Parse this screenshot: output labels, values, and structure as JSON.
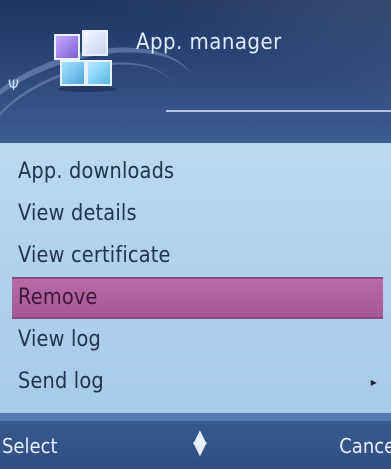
{
  "header": {
    "title": "App. manager",
    "app_icon": "app-manager-icon",
    "signal_icon": "signal-icon"
  },
  "menu": {
    "items": [
      {
        "label": "App. downloads",
        "selected": false,
        "has_submenu": false
      },
      {
        "label": "View details",
        "selected": false,
        "has_submenu": false
      },
      {
        "label": "View certificate",
        "selected": false,
        "has_submenu": false
      },
      {
        "label": "Remove",
        "selected": true,
        "has_submenu": false
      },
      {
        "label": "View log",
        "selected": false,
        "has_submenu": false
      },
      {
        "label": "Send log",
        "selected": false,
        "has_submenu": true
      }
    ],
    "submenu_arrow": "▸"
  },
  "softkeys": {
    "left": "Select",
    "middle_icon": "up-down-arrow-icon",
    "right": "Cance"
  },
  "colors": {
    "header_bg": "#2b4576",
    "menu_bg": "#b9d9f2",
    "highlight": "#b76aa8",
    "softkey_bg": "#36598f"
  }
}
